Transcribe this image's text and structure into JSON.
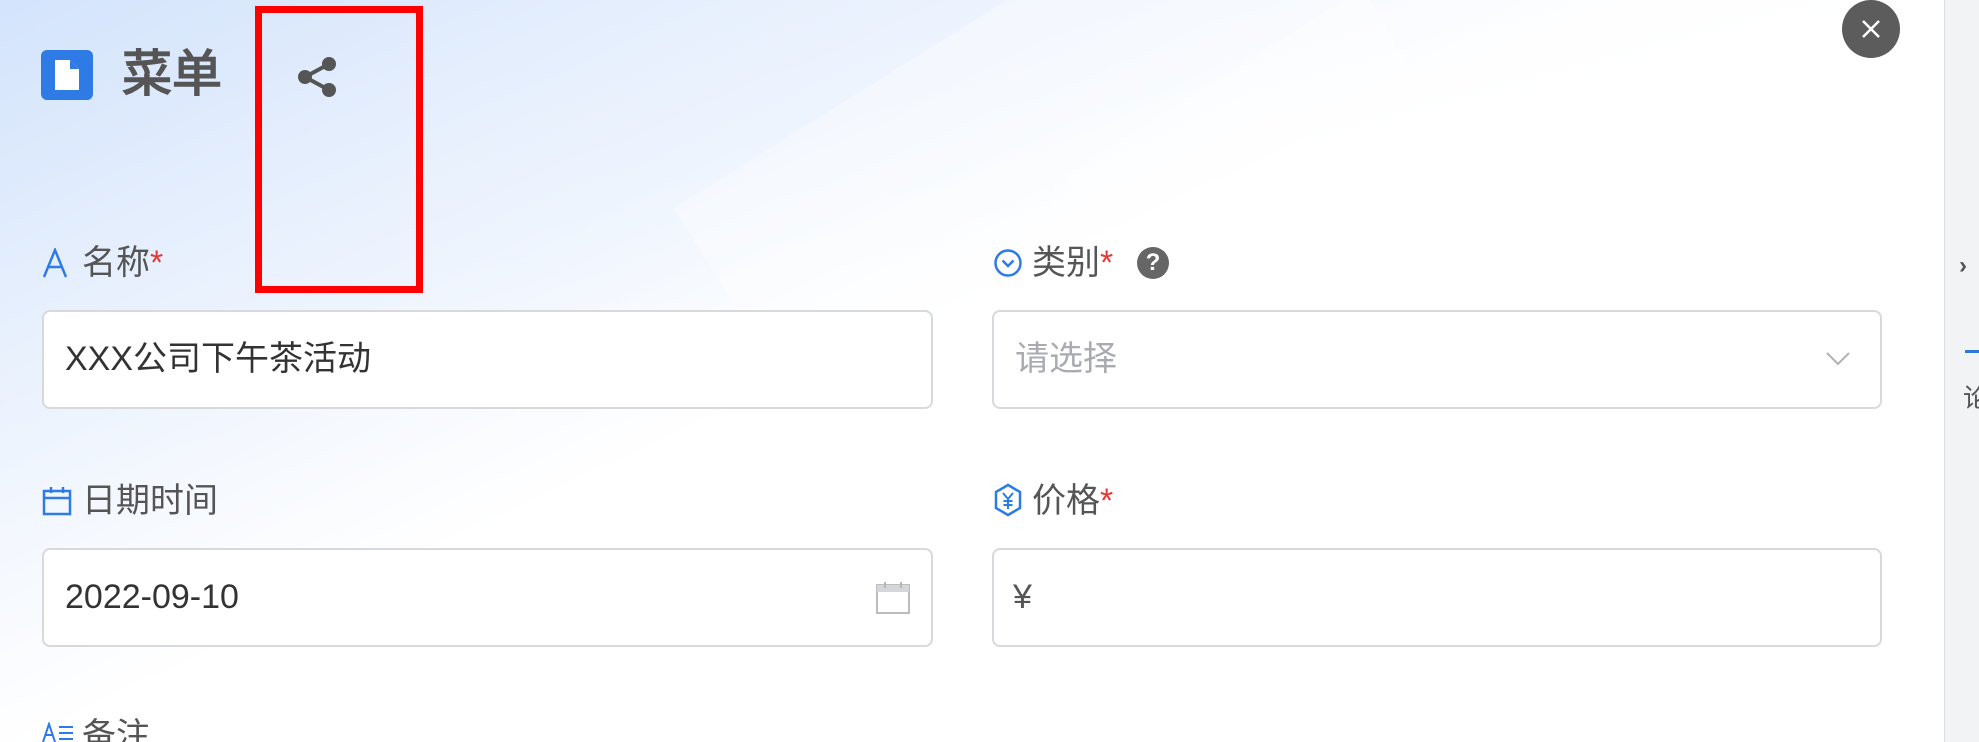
{
  "header": {
    "title": "菜单",
    "icons": {
      "doc": "document-icon",
      "share": "share-icon",
      "close": "close-icon"
    }
  },
  "form": {
    "name": {
      "label": "名称",
      "required": "*",
      "value": "XXX公司下午茶活动",
      "icon": "text-a-icon"
    },
    "category": {
      "label": "类别",
      "required": "*",
      "placeholder": "请选择",
      "help": "?",
      "icon": "chevron-circle-icon"
    },
    "datetime": {
      "label": "日期时间",
      "value": "2022-09-10",
      "icon": "calendar-icon"
    },
    "price": {
      "label": "价格",
      "required": "*",
      "prefix": "¥",
      "icon": "yuan-badge-icon"
    },
    "notes": {
      "label": "备注",
      "icon": "text-lines-icon"
    }
  },
  "side": {
    "text": "论"
  },
  "colors": {
    "accent": "#2e7be6",
    "required": "#e53935",
    "highlight": "#ff0000"
  }
}
